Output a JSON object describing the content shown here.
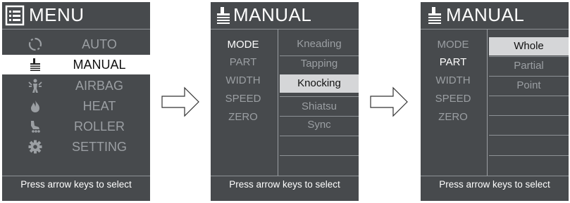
{
  "screens": {
    "menu": {
      "title": "MENU",
      "items": [
        {
          "label": "AUTO",
          "icon": "auto-cycle-icon"
        },
        {
          "label": "MANUAL",
          "icon": "hand-icon"
        },
        {
          "label": "AIRBAG",
          "icon": "airbag-icon"
        },
        {
          "label": "HEAT",
          "icon": "heat-flame-icon"
        },
        {
          "label": "ROLLER",
          "icon": "roller-foot-icon"
        },
        {
          "label": "SETTING",
          "icon": "gear-icon"
        }
      ],
      "selected_index": 1,
      "footer": "Press arrow keys to select"
    },
    "manual_techniques": {
      "title": "MANUAL",
      "modes": [
        "MODE",
        "PART",
        "WIDTH",
        "SPEED",
        "ZERO"
      ],
      "active_mode_index": 0,
      "options": [
        "Kneading",
        "Tapping",
        "Knocking",
        "Shiatsu",
        "Sync"
      ],
      "selected_option_index": 2,
      "footer": "Press arrow keys to select"
    },
    "manual_part": {
      "title": "MANUAL",
      "modes": [
        "MODE",
        "PART",
        "WIDTH",
        "SPEED",
        "ZERO"
      ],
      "active_mode_index": 1,
      "options": [
        "Whole",
        "Partial",
        "Point"
      ],
      "selected_option_index": 0,
      "footer": "Press arrow keys to select"
    }
  },
  "colors": {
    "screen_bg": "#474a4d",
    "text_active": "#ffffff",
    "text_inactive": "#9b9fa3",
    "highlight_menu": "#ffffff",
    "highlight_option": "#d5d6d8"
  }
}
